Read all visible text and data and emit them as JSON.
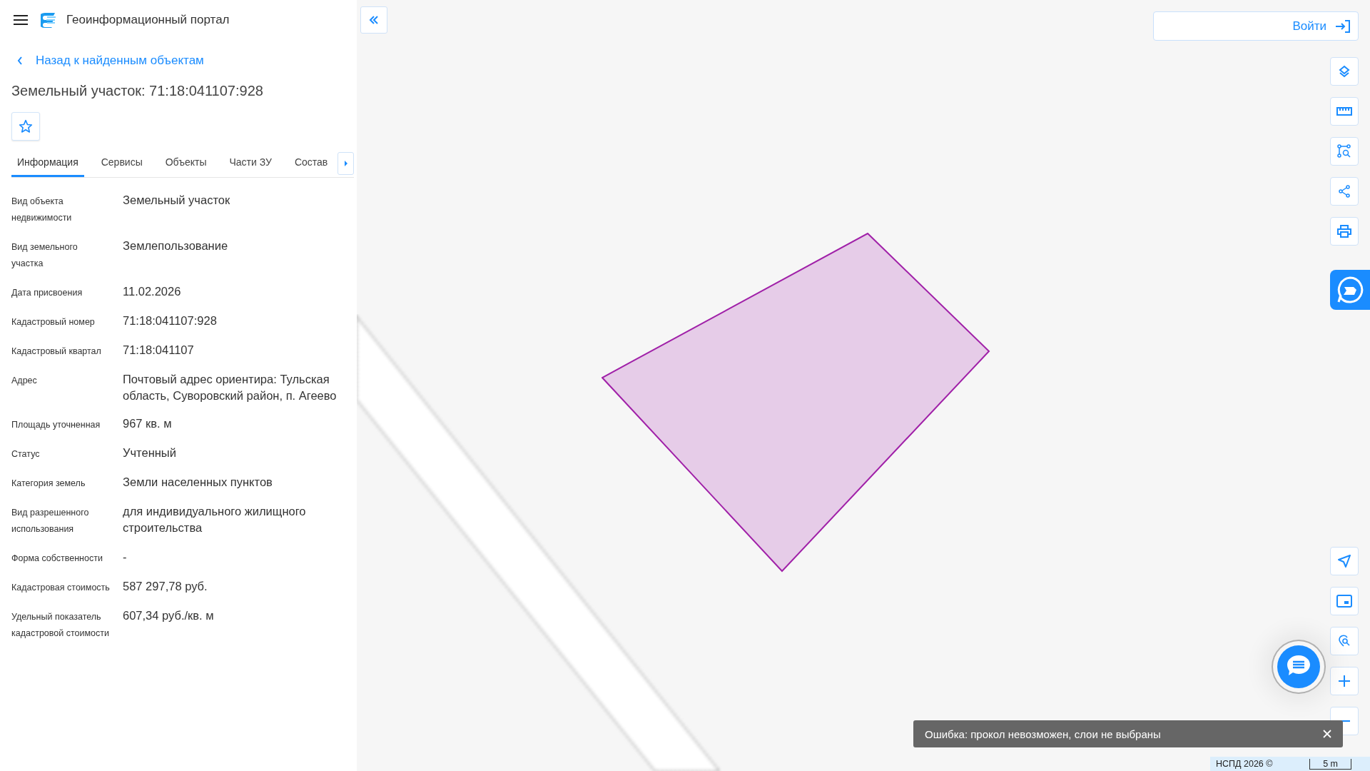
{
  "header": {
    "title": "Геоинформационный портал"
  },
  "back_link": "Назад к найденным объектам",
  "object_title": "Земельный участок: 71:18:041107:928",
  "tabs": [
    {
      "label": "Информация",
      "selected": true
    },
    {
      "label": "Сервисы",
      "selected": false
    },
    {
      "label": "Объекты",
      "selected": false
    },
    {
      "label": "Части ЗУ",
      "selected": false
    },
    {
      "label": "Состав",
      "selected": false
    }
  ],
  "fields": [
    {
      "label": "Вид объекта недвижимости",
      "value": "Земельный участок"
    },
    {
      "label": "Вид земельного участка",
      "value": "Землепользование"
    },
    {
      "label": "Дата присвоения",
      "value": "11.02.2026"
    },
    {
      "label": "Кадастровый номер",
      "value": "71:18:041107:928"
    },
    {
      "label": "Кадастровый квартал",
      "value": "71:18:041107"
    },
    {
      "label": "Адрес",
      "value": "Почтовый адрес ориентира: Тульская область, Суворовский район, п. Агеево"
    },
    {
      "label": "Площадь уточненная",
      "value": "967 кв. м"
    },
    {
      "label": "Статус",
      "value": "Учтенный"
    },
    {
      "label": "Категория земель",
      "value": "Земли населенных пунктов"
    },
    {
      "label": "Вид разрешенного использования",
      "value": "для индивидуального жилищного строительства"
    },
    {
      "label": "Форма собственности",
      "value": "-"
    },
    {
      "label": "Кадастровая стоимость",
      "value": "587 297,78 руб."
    },
    {
      "label": "Удельный показатель кадастровой стоимости",
      "value": "607,34 руб./кв. м"
    }
  ],
  "login_button": "Войти",
  "toast": {
    "message": "Ошибка: прокол невозможен, слои не выбраны"
  },
  "footer": {
    "attribution": "НСПД 2026 ©",
    "scale": "5 m"
  }
}
